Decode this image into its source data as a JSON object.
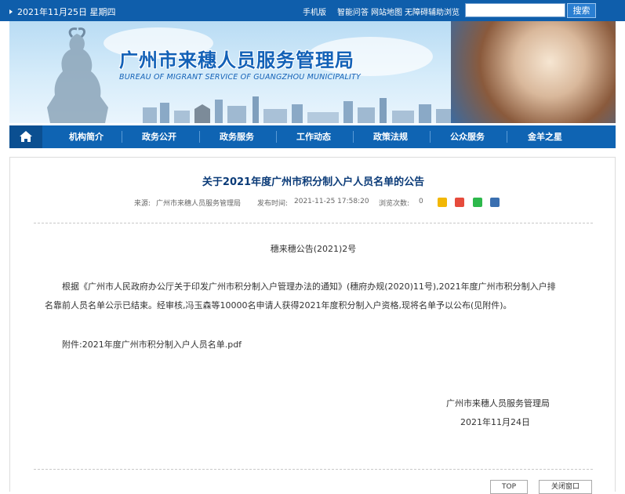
{
  "topbar": {
    "date": "2021年11月25日  星期四",
    "links": [
      "手机版",
      "智能问答",
      "网站地图",
      "无障碍辅助浏览"
    ],
    "search_placeholder": "",
    "search_button": "搜索"
  },
  "banner": {
    "title": "广州市来穗人员服务管理局",
    "subtitle": "BUREAU OF MIGRANT SERVICE OF GUANGZHOU MUNICIPALITY"
  },
  "nav": {
    "home_icon": "home-icon",
    "items": [
      "机构简介",
      "政务公开",
      "政务服务",
      "工作动态",
      "政策法规",
      "公众服务",
      "金羊之星"
    ]
  },
  "article": {
    "title": "关于2021年度广州市积分制入户人员名单的公告",
    "source_label": "来源:",
    "source": "广州市来穗人员服务管理局",
    "published_label": "发布时间:",
    "published": "2021-11-25 17:58:20",
    "views_label": "浏览次数:",
    "views": "0",
    "share_icons": [
      "star-icon",
      "weibo-icon",
      "wechat-icon",
      "qq-icon"
    ],
    "doc_number": "穗来穗公告(2021)2号",
    "body_line1": "根据《广州市人民政府办公厅关于印发广州市积分制入户管理办法的通知》(穗府办规(2020)11号),2021年度广州市积分制入户排",
    "body_line2": "名靠前人员名单公示已结束。经审核,冯玉森等10000名申请人获得2021年度积分制入户资格,现将名单予以公布(见附件)。",
    "attachment_label": "附件:",
    "attachment_link": "2021年度广州市积分制入户人员名单.pdf",
    "signature": "广州市来穗人员服务管理局",
    "sign_date": "2021年11月24日",
    "top_button": "TOP",
    "close_button": "关闭窗口"
  },
  "colors": {
    "topbar": "#0f5eab",
    "nav": "#0f64b3",
    "title": "#0b3b78",
    "banner_title": "#1361b7"
  }
}
